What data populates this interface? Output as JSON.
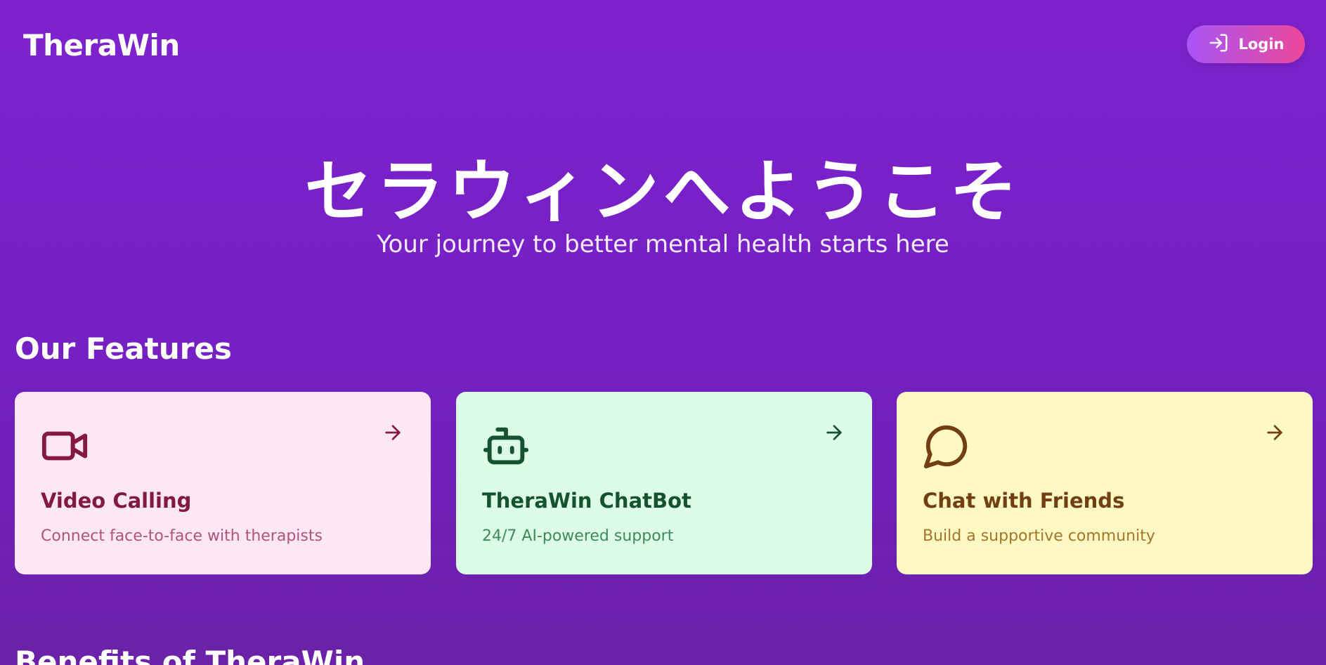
{
  "header": {
    "logo": "TheraWin",
    "login_label": "Login"
  },
  "hero": {
    "title": "セラウィンへようこそ",
    "subtitle": "Your journey to better mental health starts here"
  },
  "features": {
    "title": "Our Features",
    "cards": [
      {
        "title": "Video Calling",
        "description": "Connect face-to-face with therapists",
        "icon": "video-icon",
        "background": "#fce7f3",
        "accent": "#831843"
      },
      {
        "title": "TheraWin ChatBot",
        "description": "24/7 AI-powered support",
        "icon": "bot-icon",
        "background": "#dcfce7",
        "accent": "#14532d"
      },
      {
        "title": "Chat with Friends",
        "description": "Build a supportive community",
        "icon": "message-circle-icon",
        "background": "#fef9c3",
        "accent": "#713f12"
      }
    ]
  },
  "benefits": {
    "title": "Benefits of TheraWin"
  },
  "colors": {
    "background": "#7e22ce",
    "login_gradient_start": "#a855f7",
    "login_gradient_end": "#ec4899"
  }
}
